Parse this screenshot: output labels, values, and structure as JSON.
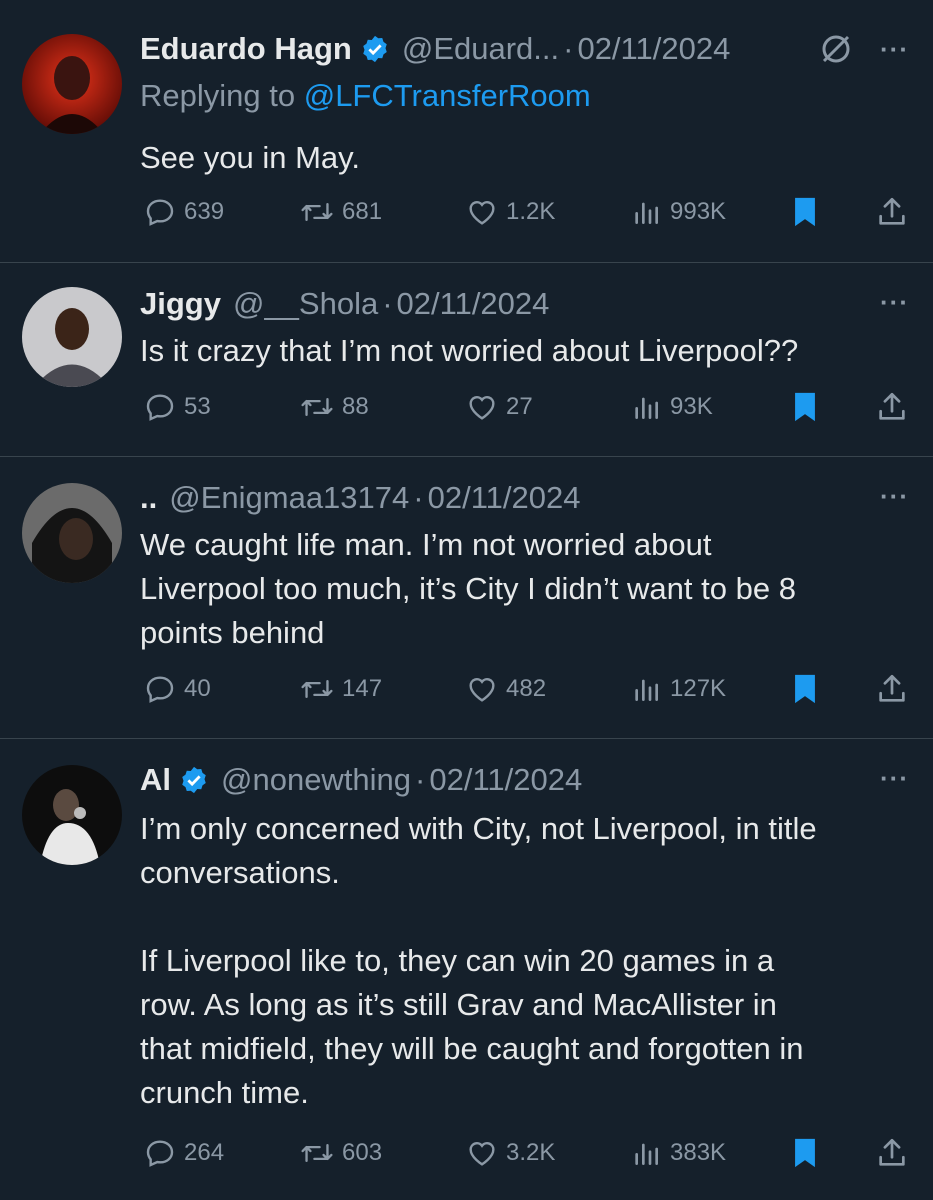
{
  "tweets": [
    {
      "name": "Eduardo Hagn",
      "verified": true,
      "handle": "@Eduard...",
      "date": "02/11/2024",
      "replying_prefix": "Replying to ",
      "replying_to": "@LFCTransferRoom",
      "text": "See you in May.",
      "replies": "639",
      "retweets": "681",
      "likes": "1.2K",
      "views": "993K",
      "bookmarked": true
    },
    {
      "name": "Jiggy",
      "verified": false,
      "handle": "@__Shola",
      "date": "02/11/2024",
      "text": "Is it crazy that I’m not worried about Liverpool??",
      "replies": "53",
      "retweets": "88",
      "likes": "27",
      "views": "93K",
      "bookmarked": true
    },
    {
      "name": "..",
      "verified": false,
      "handle": "@Enigmaa13174",
      "date": "02/11/2024",
      "text": "We caught life man. I’m not worried about\nLiverpool too much, it’s City I didn’t want to be 8\npoints behind",
      "replies": "40",
      "retweets": "147",
      "likes": "482",
      "views": "127K",
      "bookmarked": true
    },
    {
      "name": "Al",
      "verified": true,
      "handle": "@nonewthing",
      "date": "02/11/2024",
      "text": "I’m only concerned with City, not Liverpool, in title\nconversations.\n\nIf Liverpool like to, they can win 20 games in a\nrow. As long as it’s still Grav and MacAllister in\nthat midfield, they will be caught and forgotten in\ncrunch time.",
      "replies": "264",
      "retweets": "603",
      "likes": "3.2K",
      "views": "383K",
      "bookmarked": true
    }
  ],
  "separator": "·",
  "more_glyph": "···",
  "colors": {
    "background": "#15202b",
    "accent": "#1d9bf0",
    "muted": "#8b98a5",
    "text": "#e7e9ea"
  }
}
